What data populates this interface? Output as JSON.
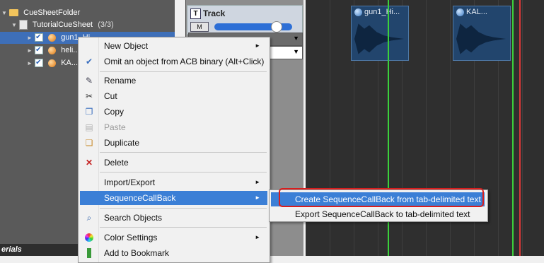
{
  "tree": {
    "items": [
      {
        "label": "CueSheetFolder",
        "kind": "folder"
      },
      {
        "label": "TutorialCueSheet",
        "count": "(3/3)",
        "kind": "cuesheet"
      },
      {
        "label": "gun1_Hi...",
        "kind": "cue",
        "selected": true
      },
      {
        "label": "heli...",
        "kind": "cue"
      },
      {
        "label": "KA...",
        "kind": "cue"
      }
    ],
    "footer_label": "erials"
  },
  "track": {
    "title": "Track",
    "t_icon": "T",
    "m_icon": "M",
    "volume_fraction": 0.83
  },
  "timeline": {
    "clips": [
      {
        "label": "gun1_Hi..."
      },
      {
        "label": "KAL..."
      }
    ],
    "marker_color_green": "#3bd13b",
    "marker_color_red": "#d83838"
  },
  "context_menu": {
    "items": [
      {
        "label": "New Object",
        "icon": "none",
        "submenu": true
      },
      {
        "label": "Omit an object from ACB binary (Alt+Click)",
        "icon": "check-icon"
      },
      {
        "label": "Rename",
        "icon": "pencil-icon"
      },
      {
        "label": "Cut",
        "icon": "scissors-icon"
      },
      {
        "label": "Copy",
        "icon": "copy-icon"
      },
      {
        "label": "Paste",
        "icon": "paste-icon",
        "disabled": true
      },
      {
        "label": "Duplicate",
        "icon": "duplicate-icon"
      },
      {
        "label": "Delete",
        "icon": "delete-x-icon"
      },
      {
        "label": "Import/Export",
        "icon": "none",
        "submenu": true
      },
      {
        "label": "SequenceCallBack",
        "icon": "none",
        "submenu": true,
        "highlighted": true
      },
      {
        "label": "Search Objects",
        "icon": "search-icon"
      },
      {
        "label": "Color Settings",
        "icon": "color-wheel-icon",
        "submenu": true
      },
      {
        "label": "Add to Bookmark",
        "icon": "bookmark-icon"
      }
    ]
  },
  "submenu": {
    "items": [
      {
        "label": "Create SequenceCallBack from tab-delimited text",
        "highlighted": true
      },
      {
        "label": "Export SequenceCallBack to tab-delimited text"
      }
    ]
  },
  "colors": {
    "menu_highlight": "#3b7fd6",
    "annotation_red": "#d81e1e",
    "tree_background": "#5a5a5a",
    "timeline_background": "#2f2f2f"
  }
}
